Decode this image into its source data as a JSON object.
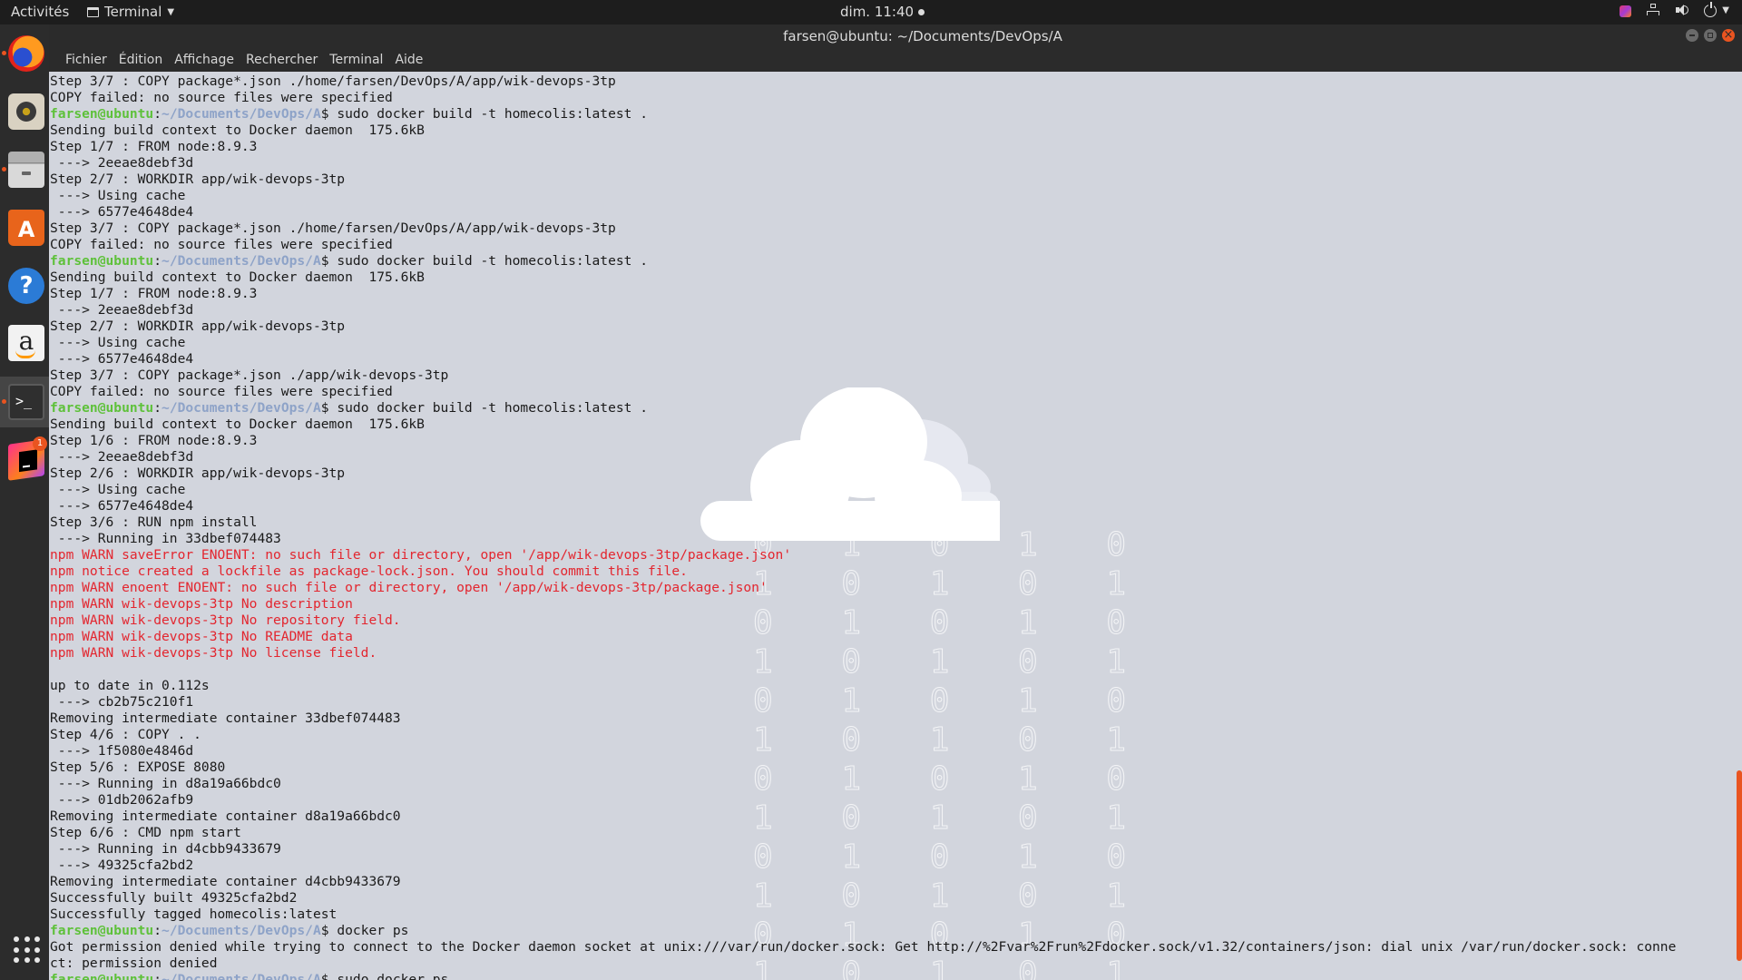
{
  "top_panel": {
    "activities": "Activités",
    "app_menu": "Terminal",
    "clock": "dim. 11:40"
  },
  "dock": {
    "items": [
      {
        "name": "firefox",
        "running": true
      },
      {
        "name": "rhythmbox",
        "running": false
      },
      {
        "name": "files",
        "running": true
      },
      {
        "name": "software",
        "running": false
      },
      {
        "name": "help",
        "running": false
      },
      {
        "name": "amazon",
        "running": false
      },
      {
        "name": "terminal",
        "running": true
      },
      {
        "name": "jetbrains-toolbox",
        "running": false,
        "badge": "1"
      }
    ]
  },
  "window": {
    "title": "farsen@ubuntu: ~/Documents/DevOps/A",
    "menu": [
      "Fichier",
      "Édition",
      "Affichage",
      "Rechercher",
      "Terminal",
      "Aide"
    ]
  },
  "terminal": {
    "prompt_user": "farsen@ubuntu",
    "prompt_path": "~/Documents/DevOps/A",
    "lines": [
      {
        "t": "out",
        "text": "Step 3/7 : COPY package*.json ./home/farsen/DevOps/A/app/wik-devops-3tp"
      },
      {
        "t": "out",
        "text": "COPY failed: no source files were specified"
      },
      {
        "t": "prompt",
        "text": "$ sudo docker build -t homecolis:latest ."
      },
      {
        "t": "out",
        "text": "Sending build context to Docker daemon  175.6kB"
      },
      {
        "t": "out",
        "text": "Step 1/7 : FROM node:8.9.3"
      },
      {
        "t": "out",
        "text": " ---> 2eeae8debf3d"
      },
      {
        "t": "out",
        "text": "Step 2/7 : WORKDIR app/wik-devops-3tp"
      },
      {
        "t": "out",
        "text": " ---> Using cache"
      },
      {
        "t": "out",
        "text": " ---> 6577e4648de4"
      },
      {
        "t": "out",
        "text": "Step 3/7 : COPY package*.json ./home/farsen/DevOps/A/app/wik-devops-3tp"
      },
      {
        "t": "out",
        "text": "COPY failed: no source files were specified"
      },
      {
        "t": "prompt",
        "text": "$ sudo docker build -t homecolis:latest ."
      },
      {
        "t": "out",
        "text": "Sending build context to Docker daemon  175.6kB"
      },
      {
        "t": "out",
        "text": "Step 1/7 : FROM node:8.9.3"
      },
      {
        "t": "out",
        "text": " ---> 2eeae8debf3d"
      },
      {
        "t": "out",
        "text": "Step 2/7 : WORKDIR app/wik-devops-3tp"
      },
      {
        "t": "out",
        "text": " ---> Using cache"
      },
      {
        "t": "out",
        "text": " ---> 6577e4648de4"
      },
      {
        "t": "out",
        "text": "Step 3/7 : COPY package*.json ./app/wik-devops-3tp"
      },
      {
        "t": "out",
        "text": "COPY failed: no source files were specified"
      },
      {
        "t": "prompt",
        "text": "$ sudo docker build -t homecolis:latest ."
      },
      {
        "t": "out",
        "text": "Sending build context to Docker daemon  175.6kB"
      },
      {
        "t": "out",
        "text": "Step 1/6 : FROM node:8.9.3"
      },
      {
        "t": "out",
        "text": " ---> 2eeae8debf3d"
      },
      {
        "t": "out",
        "text": "Step 2/6 : WORKDIR app/wik-devops-3tp"
      },
      {
        "t": "out",
        "text": " ---> Using cache"
      },
      {
        "t": "out",
        "text": " ---> 6577e4648de4"
      },
      {
        "t": "out",
        "text": "Step 3/6 : RUN npm install"
      },
      {
        "t": "out",
        "text": " ---> Running in 33dbef074483"
      },
      {
        "t": "warn",
        "text": "npm WARN saveError ENOENT: no such file or directory, open '/app/wik-devops-3tp/package.json'"
      },
      {
        "t": "warn",
        "text": "npm notice created a lockfile as package-lock.json. You should commit this file."
      },
      {
        "t": "warn",
        "text": "npm WARN enoent ENOENT: no such file or directory, open '/app/wik-devops-3tp/package.json'"
      },
      {
        "t": "warn",
        "text": "npm WARN wik-devops-3tp No description"
      },
      {
        "t": "warn",
        "text": "npm WARN wik-devops-3tp No repository field."
      },
      {
        "t": "warn",
        "text": "npm WARN wik-devops-3tp No README data"
      },
      {
        "t": "warn",
        "text": "npm WARN wik-devops-3tp No license field."
      },
      {
        "t": "out",
        "text": ""
      },
      {
        "t": "out",
        "text": "up to date in 0.112s"
      },
      {
        "t": "out",
        "text": " ---> cb2b75c210f1"
      },
      {
        "t": "out",
        "text": "Removing intermediate container 33dbef074483"
      },
      {
        "t": "out",
        "text": "Step 4/6 : COPY . ."
      },
      {
        "t": "out",
        "text": " ---> 1f5080e4846d"
      },
      {
        "t": "out",
        "text": "Step 5/6 : EXPOSE 8080"
      },
      {
        "t": "out",
        "text": " ---> Running in d8a19a66bdc0"
      },
      {
        "t": "out",
        "text": " ---> 01db2062afb9"
      },
      {
        "t": "out",
        "text": "Removing intermediate container d8a19a66bdc0"
      },
      {
        "t": "out",
        "text": "Step 6/6 : CMD npm start"
      },
      {
        "t": "out",
        "text": " ---> Running in d4cbb9433679"
      },
      {
        "t": "out",
        "text": " ---> 49325cfa2bd2"
      },
      {
        "t": "out",
        "text": "Removing intermediate container d4cbb9433679"
      },
      {
        "t": "out",
        "text": "Successfully built 49325cfa2bd2"
      },
      {
        "t": "out",
        "text": "Successfully tagged homecolis:latest"
      },
      {
        "t": "prompt",
        "text": "$ docker ps"
      },
      {
        "t": "out",
        "text": "Got permission denied while trying to connect to the Docker daemon socket at unix:///var/run/docker.sock: Get http://%2Fvar%2Frun%2Fdocker.sock/v1.32/containers/json: dial unix /var/run/docker.sock: conne"
      },
      {
        "t": "out",
        "text": "ct: permission denied"
      },
      {
        "t": "prompt",
        "text": "$ sudo docker ps"
      }
    ]
  },
  "wallpaper": {
    "binary_rows": [
      "0 1 0 1 0",
      "1 0 1 0 1",
      "0 1 0 1 0",
      "1 0 1 0 1",
      "0 1 0 1 0",
      "1 0 1 0 1",
      "0 1 0 1 0",
      "1 0 1 0 1",
      "0 1 0 1 0",
      "1 0 1 0 1",
      "0 1 0 1 0",
      "1 0 1 0 1"
    ]
  },
  "colors": {
    "prompt_user": "#5ec13a",
    "prompt_path": "#8ea3c8",
    "warning": "#e3262f",
    "accent": "#e95420"
  }
}
